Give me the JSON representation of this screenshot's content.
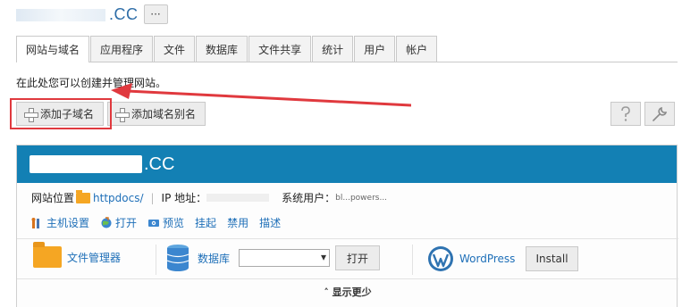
{
  "header": {
    "domain_suffix": ".CC",
    "more_label": "···"
  },
  "tabs": [
    {
      "label": "网站与域名",
      "active": true
    },
    {
      "label": "应用程序"
    },
    {
      "label": "文件"
    },
    {
      "label": "数据库"
    },
    {
      "label": "文件共享"
    },
    {
      "label": "统计"
    },
    {
      "label": "用户"
    },
    {
      "label": "帐户"
    }
  ],
  "description": "在此处您可以创建并管理网站。",
  "toolbar": {
    "add_subdomain": "添加子域名",
    "add_alias": "添加域名别名",
    "help_icon": "question-icon",
    "tools_icon": "wrench-icon"
  },
  "site": {
    "name_suffix": ".CC",
    "location_label": "网站位置",
    "location_value": "httpdocs/",
    "ip_label": "IP 地址：",
    "sysuser_label": "系统用户：",
    "sysuser_value": "bl...powers..."
  },
  "actions": [
    {
      "label": "主机设置",
      "icon": "hosting-settings-icon"
    },
    {
      "label": "打开",
      "icon": "open-globe-icon"
    },
    {
      "label": "预览",
      "icon": "preview-icon"
    },
    {
      "label": "挂起"
    },
    {
      "label": "禁用"
    },
    {
      "label": "描述"
    }
  ],
  "tools": {
    "file_manager": "文件管理器",
    "database": "数据库",
    "open": "打开",
    "wordpress": "WordPress",
    "install": "Install"
  },
  "show_less": "显示更少",
  "colors": {
    "accent": "#1380b4",
    "link": "#1e6fb8",
    "highlight": "#e0393e",
    "folder": "#f5a623"
  }
}
